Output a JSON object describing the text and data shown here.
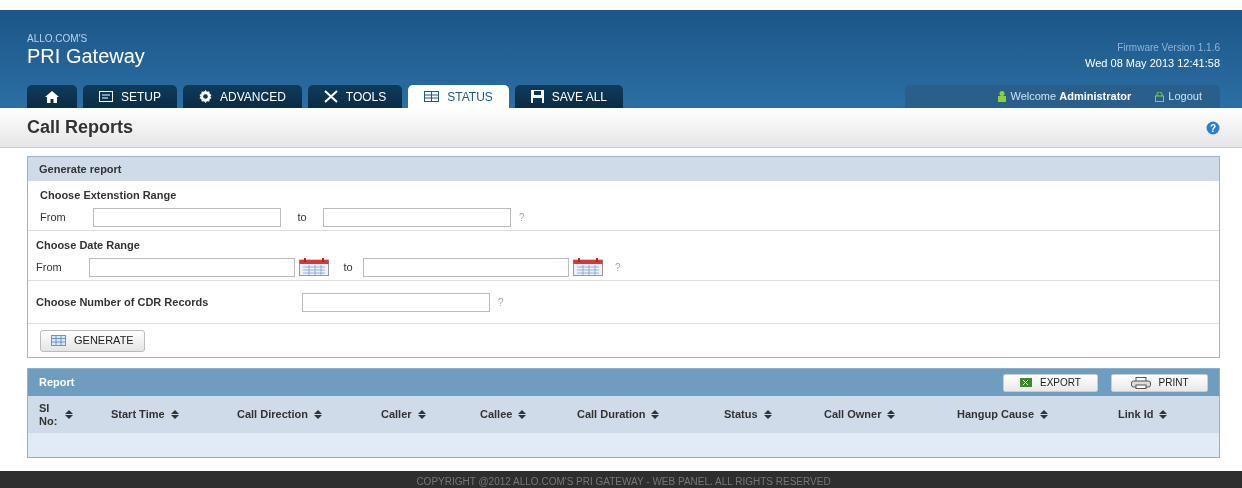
{
  "header": {
    "brand_small": "ALLO.COM'S",
    "brand": "PRI Gateway",
    "firmware": "Firmware Version 1.1.6",
    "datetime": "Wed 08 May 2013 12:41:58"
  },
  "tabs": [
    {
      "kind": "home",
      "selected": false
    },
    {
      "kind": "setup",
      "label": "SETUP",
      "selected": false
    },
    {
      "kind": "advanced",
      "label": "ADVANCED",
      "selected": false
    },
    {
      "kind": "tools",
      "label": "TOOLS",
      "selected": false
    },
    {
      "kind": "status",
      "label": "STATUS",
      "selected": true
    },
    {
      "kind": "save",
      "label": "SAVE ALL",
      "selected": false
    }
  ],
  "user": {
    "welcome": "Welcome",
    "name": "Administrator",
    "logout": "Logout"
  },
  "page_title": "Call Reports",
  "help_icon": "?",
  "generate": {
    "title": "Generate report",
    "extension": {
      "label": "Choose Extenstion Range",
      "from": "From",
      "to": "to",
      "help": "?"
    },
    "date": {
      "label": "Choose Date Range",
      "from": "From",
      "to": "to",
      "help": "?"
    },
    "records": {
      "label": "Choose Number of CDR Records",
      "help": "?"
    },
    "button": "GENERATE"
  },
  "report": {
    "title": "Report",
    "export": "EXPORT",
    "print": "PRINT",
    "columns": [
      "SI No:",
      "Start Time",
      "Call Direction",
      "Caller",
      "Callee",
      "Call Duration",
      "Status",
      "Call Owner",
      "Hangup Cause",
      "Link Id"
    ]
  },
  "footer": "COPYRIGHT @2012  ALLO.COM'S PRI GATEWAY - WEB PANEL. ALL RIGHTS RESERVED"
}
